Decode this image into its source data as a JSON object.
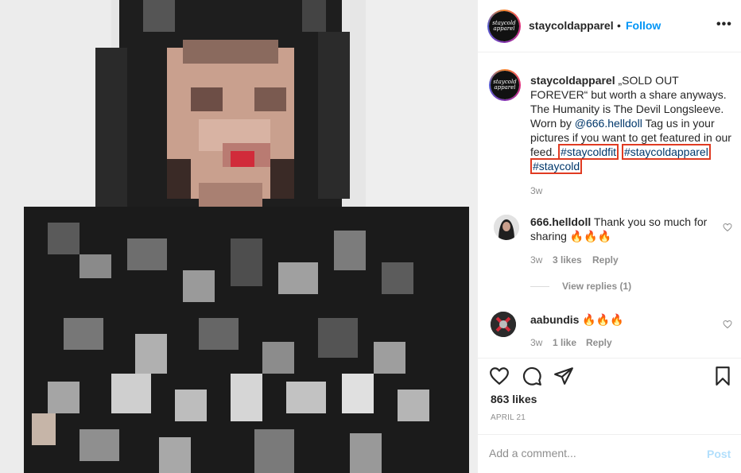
{
  "post": {
    "photo_alt": "pixelated photo",
    "account": {
      "username": "staycoldapparel",
      "avatar_text": "staycold apparel",
      "follow_label": "Follow",
      "dot": "•",
      "more_label": "•••"
    },
    "caption": {
      "username": "staycoldapparel",
      "part1": " „SOLD OUT FOREVER“ but worth a share anyways. The Humanity is The Devil Longsleeve. Worn by ",
      "mention": "@666.helldoll",
      "part2": " Tag us in your pictures if you want to get featured in our feed. ",
      "hashtags": [
        "#staycoldfit",
        "#staycoldapparel",
        "#staycold"
      ],
      "time": "3w"
    },
    "comments": [
      {
        "username": "666.helldoll",
        "text": " Thank you so much for sharing 🔥🔥🔥",
        "time": "3w",
        "likes": "3 likes",
        "reply_label": "Reply",
        "view_replies": "View replies (1)"
      },
      {
        "username": "aabundis",
        "text": " 🔥🔥🔥",
        "time": "3w",
        "likes": "1 like",
        "reply_label": "Reply"
      }
    ],
    "likes": "863 likes",
    "date": "APRIL 21",
    "comment_placeholder": "Add a comment...",
    "post_label": "Post"
  },
  "colors": {
    "link": "#00376b",
    "follow": "#0095f6",
    "highlight": "#e03b22",
    "muted": "#8e8e8e",
    "post_disabled": "#b2dffc"
  }
}
